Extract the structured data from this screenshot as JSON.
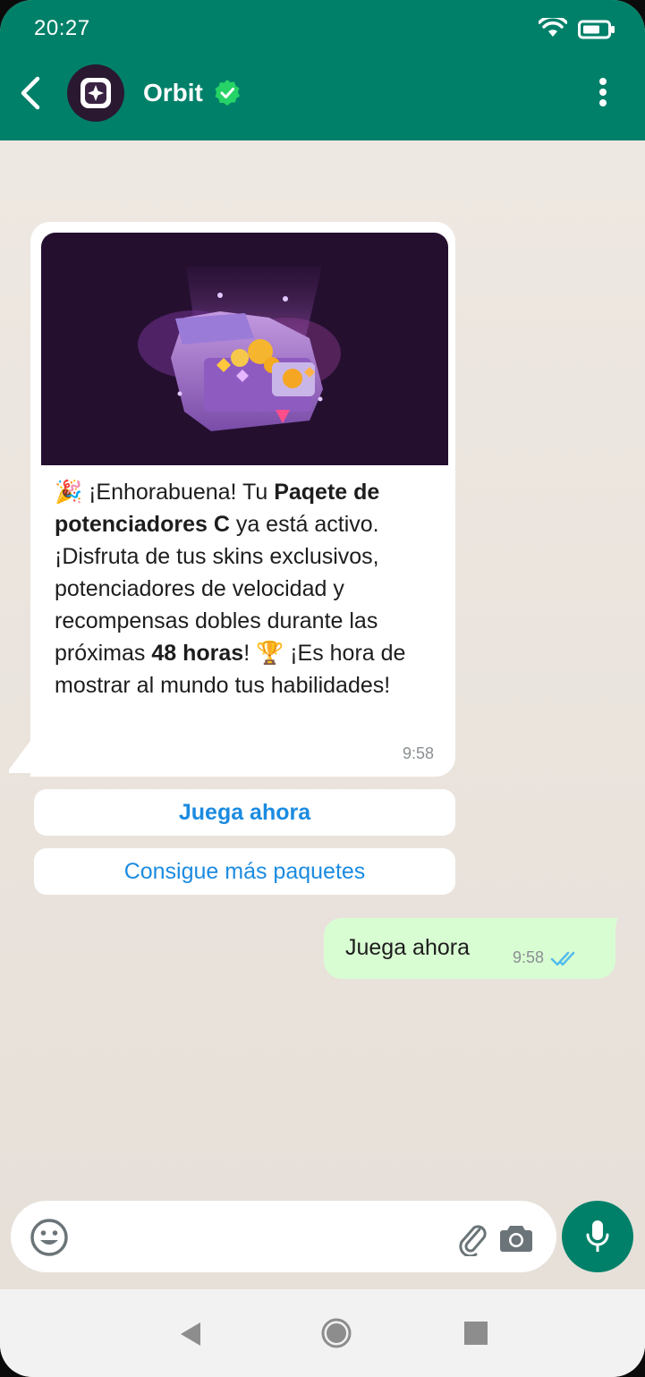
{
  "status_bar": {
    "time": "20:27"
  },
  "header": {
    "contact_name": "Orbit",
    "verified": true,
    "back_icon": "chevron-left-icon",
    "menu_icon": "more-vertical-icon"
  },
  "received_message": {
    "image_alt": "treasure chest illustration",
    "text_parts": {
      "p1": "¡Enhorabuena! Tu ",
      "b1": "Paqete de potenciadores C",
      "p2": " ya está activo. ¡Disfruta de tus skins exclusivos, potenciadores de velocidad y recompensas dobles durante las próximas ",
      "b2": "48 horas",
      "p3": "! ",
      "p4": " ¡Es hora de mostrar al mundo tus habilidades!"
    },
    "emoji_start": "🎉",
    "emoji_trophy": "🏆",
    "time": "9:58"
  },
  "quick_replies": [
    {
      "label": "Juega ahora"
    },
    {
      "label": "Consigue más paquetes"
    }
  ],
  "sent_message": {
    "text": "Juega ahora",
    "time": "9:58",
    "status": "read"
  },
  "composer": {
    "emoji_icon": "emoji-icon",
    "attach_icon": "paperclip-icon",
    "camera_icon": "camera-icon",
    "mic_icon": "microphone-icon"
  },
  "colors": {
    "header": "#008069",
    "sent_bubble": "#d9fdd3",
    "link": "#1b8be0",
    "read_ticks": "#53bdeb"
  }
}
